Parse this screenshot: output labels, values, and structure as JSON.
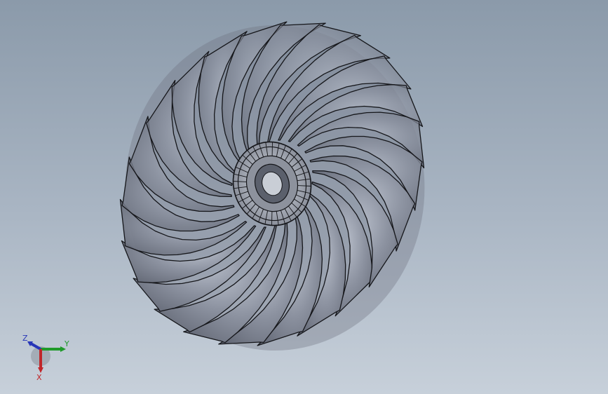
{
  "viewport": {
    "background_top": "#8b9aaa",
    "background_bottom": "#c7d0da"
  },
  "model": {
    "name": "axial-fan-impeller",
    "blade_count": 24,
    "blade_color": "#7b808e",
    "edge_color": "#15161a"
  },
  "triad": {
    "axis_x_label": "X",
    "axis_y_label": "Y",
    "axis_z_label": "Z",
    "x_color": "#c0262a",
    "y_color": "#1f9a2a",
    "z_color": "#2836b8"
  }
}
